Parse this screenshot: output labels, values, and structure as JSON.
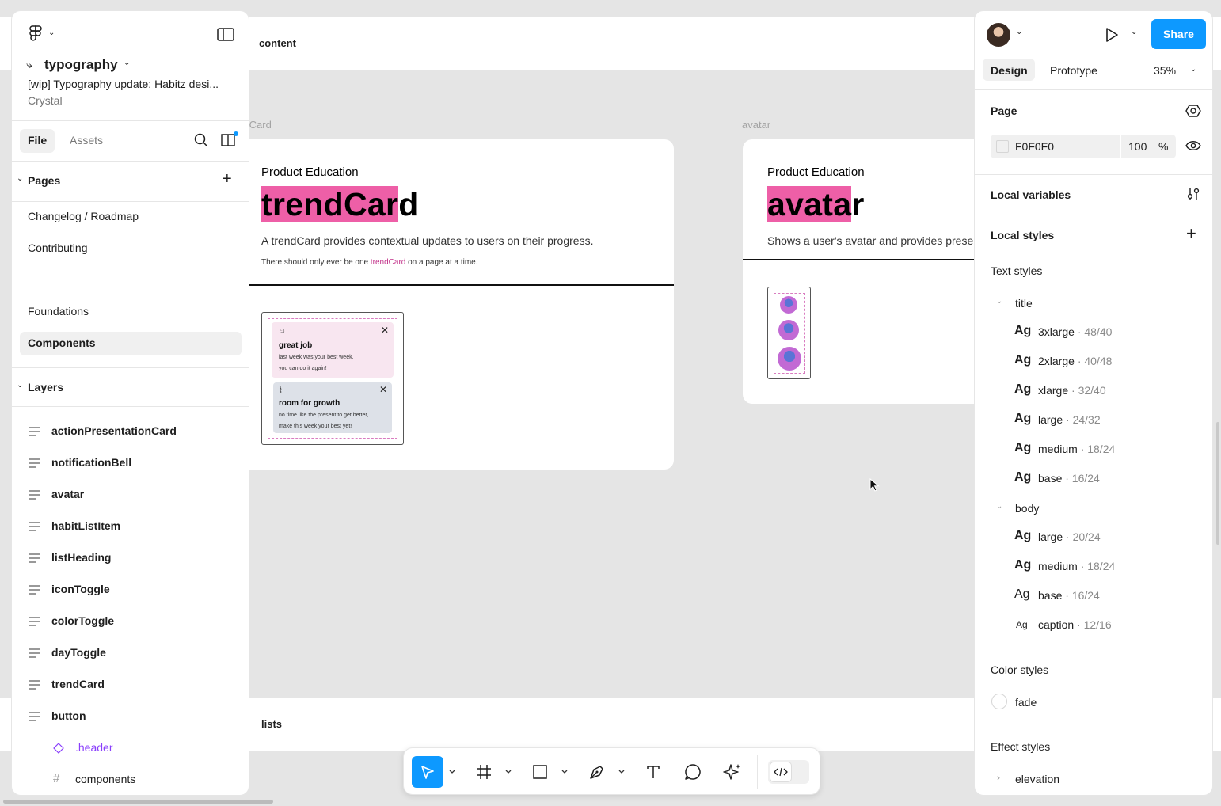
{
  "canvas": {
    "sections": [
      {
        "label": "content"
      },
      {
        "label": "lists"
      }
    ],
    "frames": [
      {
        "frame_label": "trendCard",
        "eyebrow": "Product Education",
        "title_highlight": "trendCar",
        "title_rest": "d",
        "description": "A trendCard provides contextual updates to users on their progress.",
        "note_before": "There should only ever be one ",
        "note_link": "trendCard",
        "note_after": " on a page at a time.",
        "preview": {
          "note1": {
            "title": "great job",
            "line1": "last week was your best week,",
            "line2": "you can do it again!"
          },
          "note2": {
            "title": "room for growth",
            "line1": "no time like the present to get better,",
            "line2": "make this week your best yet!"
          }
        }
      },
      {
        "frame_label": "avatar",
        "eyebrow": "Product Education",
        "title_highlight": "avata",
        "title_rest": "r",
        "description": "Shows a user's avatar and provides prese"
      }
    ]
  },
  "left_panel": {
    "branch_name": "typography",
    "file_name": "[wip] Typography update: Habitz desi...",
    "team": "Crystal",
    "tabs": {
      "file": "File",
      "assets": "Assets"
    },
    "pages_heading": "Pages",
    "pages": [
      "Changelog / Roadmap",
      "Contributing",
      "Foundations",
      "Components"
    ],
    "selected_page": "Components",
    "layers_heading": "Layers",
    "layers": [
      "actionPresentationCard",
      "notificationBell",
      "avatar",
      "habitListItem",
      "listHeading",
      "iconToggle",
      "colorToggle",
      "dayToggle",
      "trendCard",
      "button"
    ],
    "sublayers": [
      {
        "name": ".header",
        "icon": "component-instance-icon",
        "color": "#8a3ffc"
      },
      {
        "name": "components",
        "icon": "frame-hash-icon"
      }
    ]
  },
  "right_panel": {
    "share_label": "Share",
    "tabs": {
      "design": "Design",
      "prototype": "Prototype"
    },
    "zoom": "35%",
    "page_heading": "Page",
    "page_color": "F0F0F0",
    "page_opacity": "100",
    "percent_sign": "%",
    "local_variables": "Local variables",
    "local_styles": "Local styles",
    "text_styles_heading": "Text styles",
    "text_groups": [
      {
        "name": "title",
        "styles": [
          {
            "ag": "Ag",
            "name": "3xlarge",
            "value": "· 48/40"
          },
          {
            "ag": "Ag",
            "name": "2xlarge",
            "value": "· 40/48"
          },
          {
            "ag": "Ag",
            "name": "xlarge",
            "value": "· 32/40"
          },
          {
            "ag": "Ag",
            "name": "large",
            "value": "· 24/32"
          },
          {
            "ag": "Ag",
            "name": "medium",
            "value": "· 18/24"
          },
          {
            "ag": "Ag",
            "name": "base",
            "value": "· 16/24"
          }
        ]
      },
      {
        "name": "body",
        "styles": [
          {
            "ag": "Ag",
            "name": "large",
            "value": "· 20/24"
          },
          {
            "ag": "Ag",
            "name": "medium",
            "value": "· 18/24"
          },
          {
            "ag": "Ag",
            "name": "base",
            "value": "· 16/24"
          },
          {
            "ag": "Ag",
            "name": "caption",
            "value": "· 12/16"
          }
        ]
      }
    ],
    "color_styles_heading": "Color styles",
    "color_styles": [
      {
        "name": "fade"
      }
    ],
    "effect_styles_heading": "Effect styles",
    "effect_styles": [
      {
        "name": "elevation"
      }
    ]
  },
  "colors": {
    "accent": "#0d99ff",
    "highlight": "#ee5fa7",
    "link_pink": "#c2338a",
    "canvas_bg": "#e5e5e5"
  }
}
